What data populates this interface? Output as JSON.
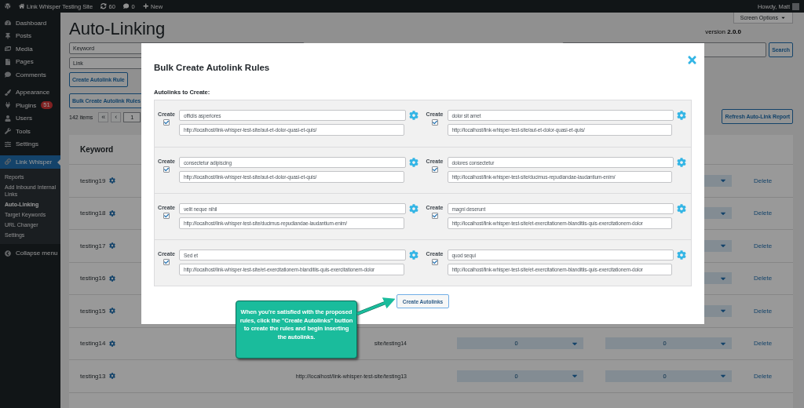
{
  "admin_bar": {
    "site": "Link Whisper Testing Site",
    "updates": "60",
    "comments": "0",
    "new": "New",
    "greeting": "Howdy, Matt"
  },
  "sidebar": {
    "items": [
      {
        "label": "Dashboard",
        "selected": false
      },
      {
        "label": "Posts",
        "selected": false
      },
      {
        "label": "Media",
        "selected": false
      },
      {
        "label": "Pages",
        "selected": false
      },
      {
        "label": "Comments",
        "selected": false
      },
      {
        "label": "Appearance",
        "selected": false
      },
      {
        "label": "Plugins",
        "selected": false,
        "badge": "51"
      },
      {
        "label": "Users",
        "selected": false
      },
      {
        "label": "Tools",
        "selected": false
      },
      {
        "label": "Settings",
        "selected": false
      },
      {
        "label": "Link Whisper",
        "selected": true
      }
    ],
    "submenu": [
      {
        "label": "Reports",
        "selected": false
      },
      {
        "label": "Add Inbound Internal Links",
        "selected": false
      },
      {
        "label": "Auto-Linking",
        "selected": true
      },
      {
        "label": "Target Keywords",
        "selected": false
      },
      {
        "label": "URL Changer",
        "selected": false
      },
      {
        "label": "Settings",
        "selected": false
      }
    ],
    "collapse": "Collapse menu"
  },
  "page": {
    "title": "Auto-Linking",
    "screen_options": "Screen Options",
    "version": "version **2.0.0**",
    "keyword_placeholder": "Keyword",
    "link_placeholder": "Link",
    "create_button": "Create Autolink Rule",
    "bulk_button": "Bulk Create Autolink Rules",
    "search_button": "Search",
    "refresh_button": "Refresh Auto-Link Report",
    "items_count": "142 items",
    "pagination": {
      "first": "«",
      "prev": "‹",
      "current": "1"
    }
  },
  "table": {
    "columns": [
      "Keyword"
    ],
    "rows": [
      {
        "keyword": "testing19",
        "action": "Delete"
      },
      {
        "keyword": "testing18",
        "action": "Delete"
      },
      {
        "keyword": "testing17",
        "action": "Delete"
      },
      {
        "keyword": "testing16",
        "action": "Delete"
      },
      {
        "keyword": "testing15",
        "action": "Delete"
      },
      {
        "keyword": "testing14",
        "link": "site/testing14",
        "count_1": "0",
        "count_2": "0",
        "action": "Delete"
      },
      {
        "keyword": "testing13",
        "link": "http://localhost/link-whisper-test-site/testing13",
        "count_1": "0",
        "count_2": "0",
        "action": "Delete"
      }
    ]
  },
  "modal": {
    "title": "Bulk Create Autolink Rules",
    "section_label": "Autolinks to Create:",
    "rules": [
      {
        "label": "Create",
        "checked": true,
        "keyword": "officiis asperiores",
        "link": "http://localhost/link-whisper-test-site/aut-et-dolor-quasi-et-quis/"
      },
      {
        "label": "Create",
        "checked": true,
        "keyword": "dolor sit amet",
        "link": "http://localhost/link-whisper-test-site/aut-et-dolor-quasi-et-quis/"
      },
      {
        "label": "Create",
        "checked": true,
        "keyword": "consectetur adipiscing",
        "link": "http://localhost/link-whisper-test-site/aut-et-dolor-quasi-et-quis/"
      },
      {
        "label": "Create",
        "checked": true,
        "keyword": "dolores consectetur",
        "link": "http://localhost/link-whisper-test-site/ducimus-repudiandae-laudantium-enim/"
      },
      {
        "label": "Create",
        "checked": true,
        "keyword": "velit neque nihil",
        "link": "http://localhost/link-whisper-test-site/ducimus-repudiandae-laudantium-enim/"
      },
      {
        "label": "Create",
        "checked": true,
        "keyword": "magni deserunt",
        "link": "http://localhost/link-whisper-test-site/et-exercitationem-blanditiis-quis-exercitationem-dolor"
      },
      {
        "label": "Create",
        "checked": true,
        "keyword": "Sed et",
        "link": "http://localhost/link-whisper-test-site/et-exercitationem-blanditiis-quis-exercitationem-dolor"
      },
      {
        "label": "Create",
        "checked": true,
        "keyword": "quod sequi",
        "link": "http://localhost/link-whisper-test-site/et-exercitationem-blanditiis-quis-exercitationem-dolor"
      }
    ],
    "submit": "Create Autolinks"
  },
  "callout": {
    "text": "When you're satisfied with the proposed rules, click the \"Create Autolinks\" button to create the rules and begin inserting the autolinks."
  }
}
